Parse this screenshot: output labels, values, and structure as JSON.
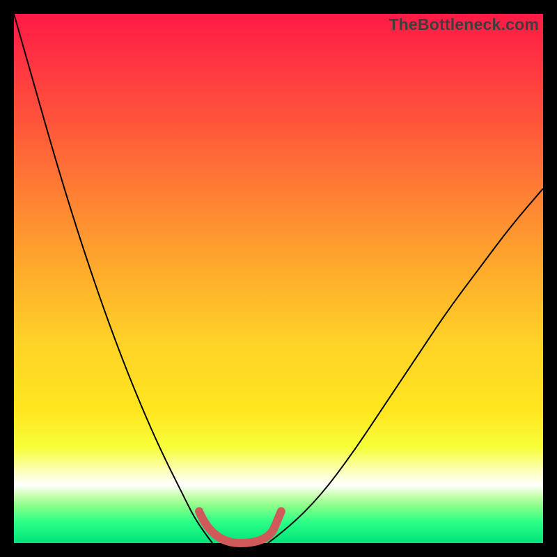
{
  "watermark": "TheBottleneck.com",
  "chart_data": {
    "type": "line",
    "title": "",
    "xlabel": "",
    "ylabel": "",
    "xlim": [
      0,
      100
    ],
    "ylim": [
      0,
      100
    ],
    "grid": false,
    "legend": false,
    "gradient_stops": [
      {
        "offset": 0,
        "color": "#ff1a46"
      },
      {
        "offset": 22,
        "color": "#ff5a3a"
      },
      {
        "offset": 45,
        "color": "#ffa12e"
      },
      {
        "offset": 62,
        "color": "#ffd227"
      },
      {
        "offset": 75,
        "color": "#ffe61f"
      },
      {
        "offset": 82,
        "color": "#f6ff3a"
      },
      {
        "offset": 86,
        "color": "#fbffb0"
      },
      {
        "offset": 89,
        "color": "#ffffff"
      },
      {
        "offset": 91,
        "color": "#c9ffb0"
      },
      {
        "offset": 93,
        "color": "#88ff88"
      },
      {
        "offset": 96,
        "color": "#2cff87"
      },
      {
        "offset": 100,
        "color": "#00e37a"
      }
    ],
    "series": [
      {
        "name": "left-curve",
        "stroke": "#000000",
        "stroke_width": 2,
        "x": [
          0,
          4,
          8,
          12,
          16,
          20,
          24,
          28,
          32,
          34,
          36,
          37.5
        ],
        "y": [
          100,
          86,
          72,
          59,
          47,
          36,
          26,
          17,
          9,
          5,
          2,
          0
        ]
      },
      {
        "name": "right-curve",
        "stroke": "#000000",
        "stroke_width": 2,
        "x": [
          48,
          52,
          58,
          64,
          70,
          76,
          82,
          88,
          94,
          100
        ],
        "y": [
          0,
          3,
          9,
          17,
          26,
          35,
          44,
          52,
          60,
          67
        ]
      },
      {
        "name": "center-bracket",
        "stroke": "#d05a5a",
        "stroke_width": 12,
        "linecap": "round",
        "x": [
          35,
          37.5,
          48,
          50.5
        ],
        "y": [
          6,
          0,
          0,
          6
        ]
      }
    ]
  }
}
